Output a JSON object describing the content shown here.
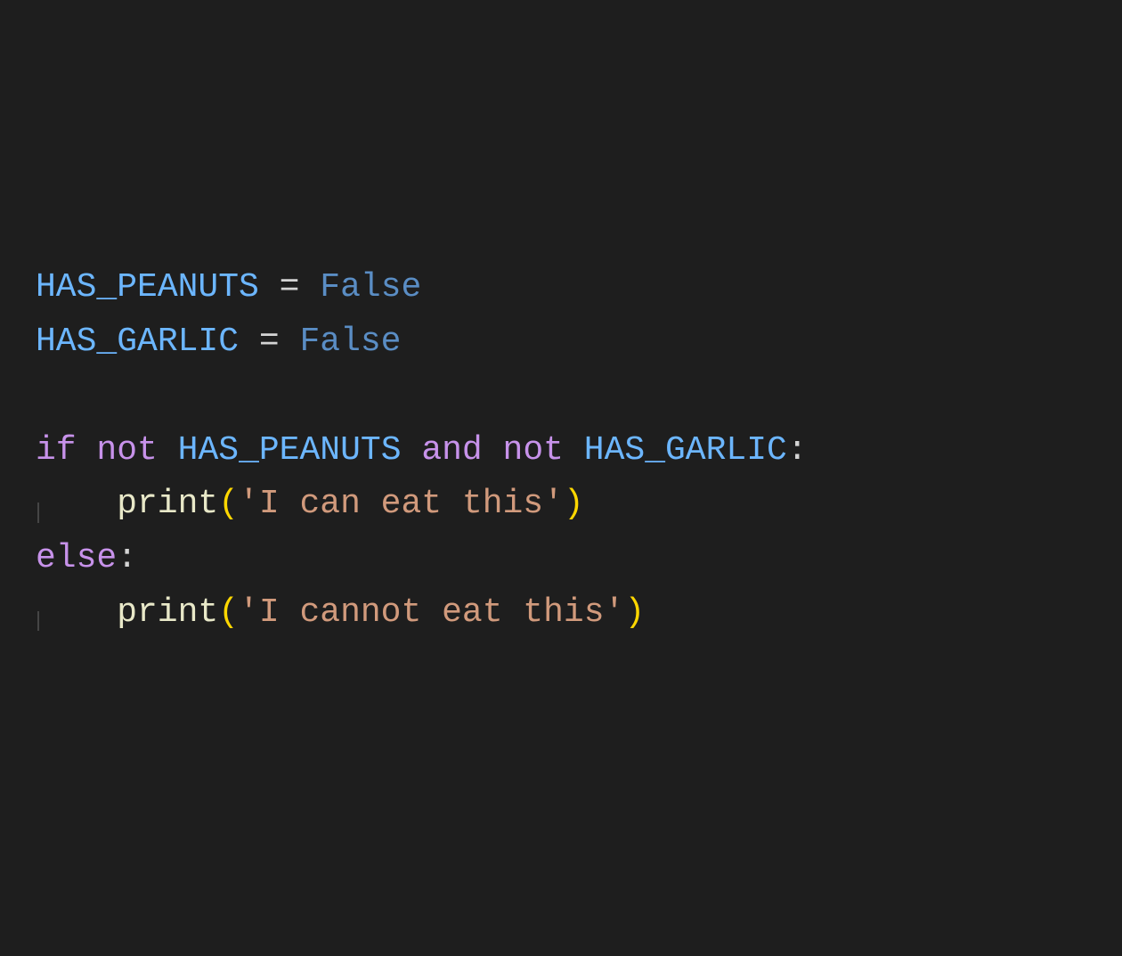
{
  "code": {
    "line1": {
      "var": "HAS_PEANUTS",
      "op": " = ",
      "val": "False"
    },
    "line2": {
      "var": "HAS_GARLIC",
      "op": " = ",
      "val": "False"
    },
    "line4": {
      "kw_if": "if",
      "sp1": " ",
      "kw_not1": "not",
      "sp2": " ",
      "var1": "HAS_PEANUTS",
      "sp3": " ",
      "kw_and": "and",
      "sp4": " ",
      "kw_not2": "not",
      "sp5": " ",
      "var2": "HAS_GARLIC",
      "colon": ":"
    },
    "line5": {
      "fn": "print",
      "lp": "(",
      "str": "'I can eat this'",
      "rp": ")"
    },
    "line6": {
      "kw_else": "else",
      "colon": ":"
    },
    "line7": {
      "fn": "print",
      "lp": "(",
      "str": "'I cannot eat this'",
      "rp": ")"
    }
  }
}
